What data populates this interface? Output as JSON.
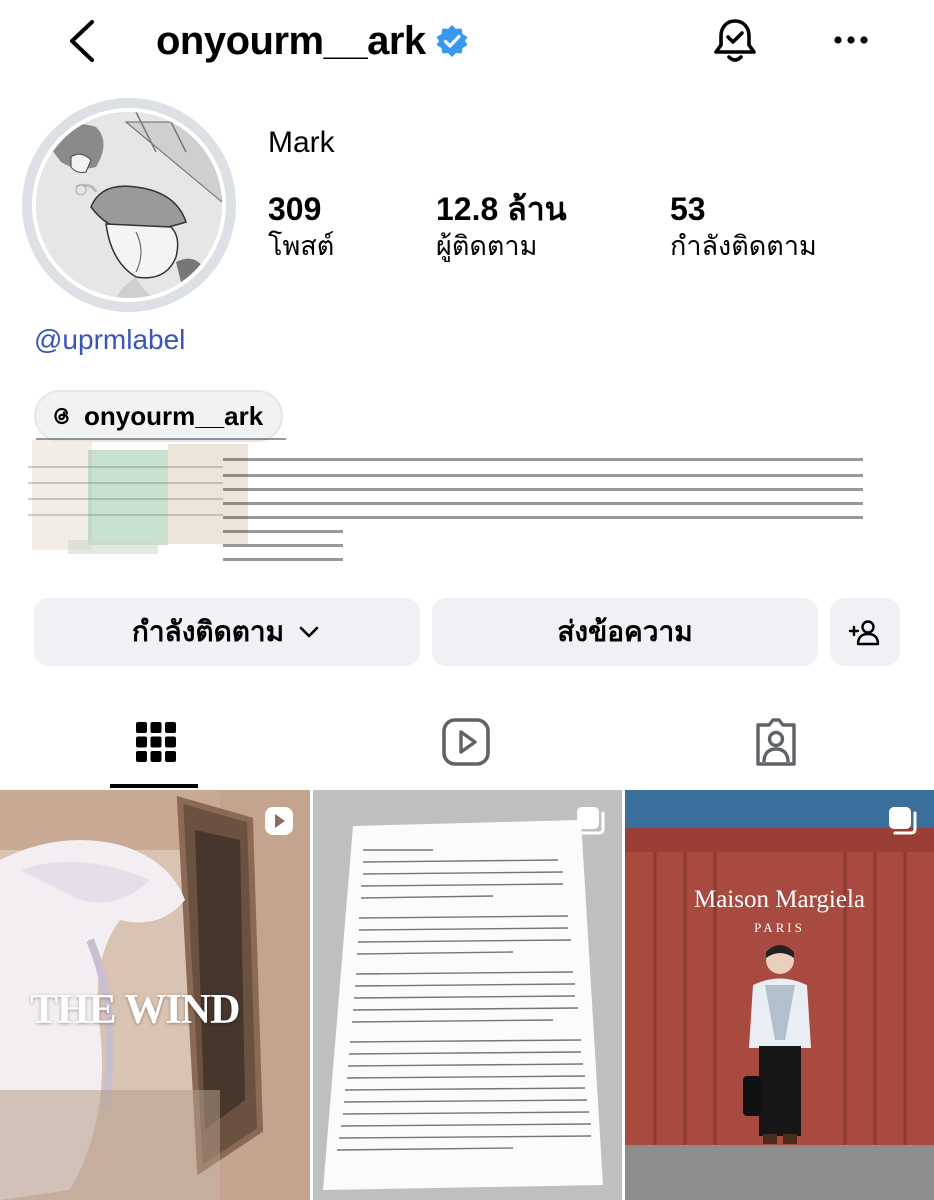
{
  "header": {
    "username": "onyourm__ark",
    "back_icon": "chevron-left-icon",
    "bell_icon": "notification-bell-icon",
    "more_icon": "more-horizontal-icon",
    "verified_color": "#3897f0"
  },
  "profile": {
    "display_name": "Mark",
    "stats": [
      {
        "value": "309",
        "label": "โพสต์"
      },
      {
        "value": "12.8 ล้าน",
        "label": "ผู้ติดตาม"
      },
      {
        "value": "53",
        "label": "กำลังติดตาม"
      }
    ],
    "mention": "@uprmlabel",
    "threads_handle": "onyourm__ark"
  },
  "actions": {
    "following_label": "กำลังติดตาม",
    "message_label": "ส่งข้อความ"
  },
  "tabs": [
    {
      "icon": "grid-icon",
      "active": true
    },
    {
      "icon": "reels-icon",
      "active": false
    },
    {
      "icon": "tagged-icon",
      "active": false
    }
  ],
  "posts": [
    {
      "overlay_text": "THE WIND",
      "badge": "reel-icon"
    },
    {
      "overlay_text": "",
      "badge": "carousel-icon"
    },
    {
      "overlay_title": "Maison Margiela",
      "overlay_subtitle": "PARIS",
      "badge": "carousel-icon"
    }
  ],
  "colors": {
    "link": "#3b55b6",
    "button_bg": "#eff1f4",
    "avatar_ring": "#dde0e4"
  }
}
